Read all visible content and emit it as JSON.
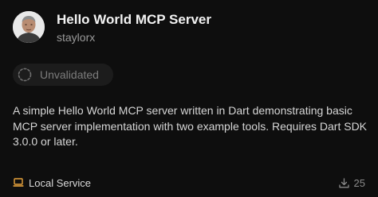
{
  "server": {
    "title": "Hello World MCP Server",
    "author": "staylorx",
    "avatar_icon": "user-photo"
  },
  "status": {
    "label": "Unvalidated",
    "icon": "dashed-circle-icon"
  },
  "description": "A simple Hello World MCP server written in Dart demonstrating basic MCP server implementation with two example tools. Requires Dart SDK 3.0.0 or later.",
  "footer": {
    "service_label": "Local Service",
    "service_icon": "laptop-icon",
    "download_count": "25",
    "download_icon": "download-icon"
  },
  "colors": {
    "background": "#0e0e0e",
    "accent": "#e8a33c",
    "badge_bg": "#1c1c1c",
    "muted_text": "#9a9a9a"
  }
}
